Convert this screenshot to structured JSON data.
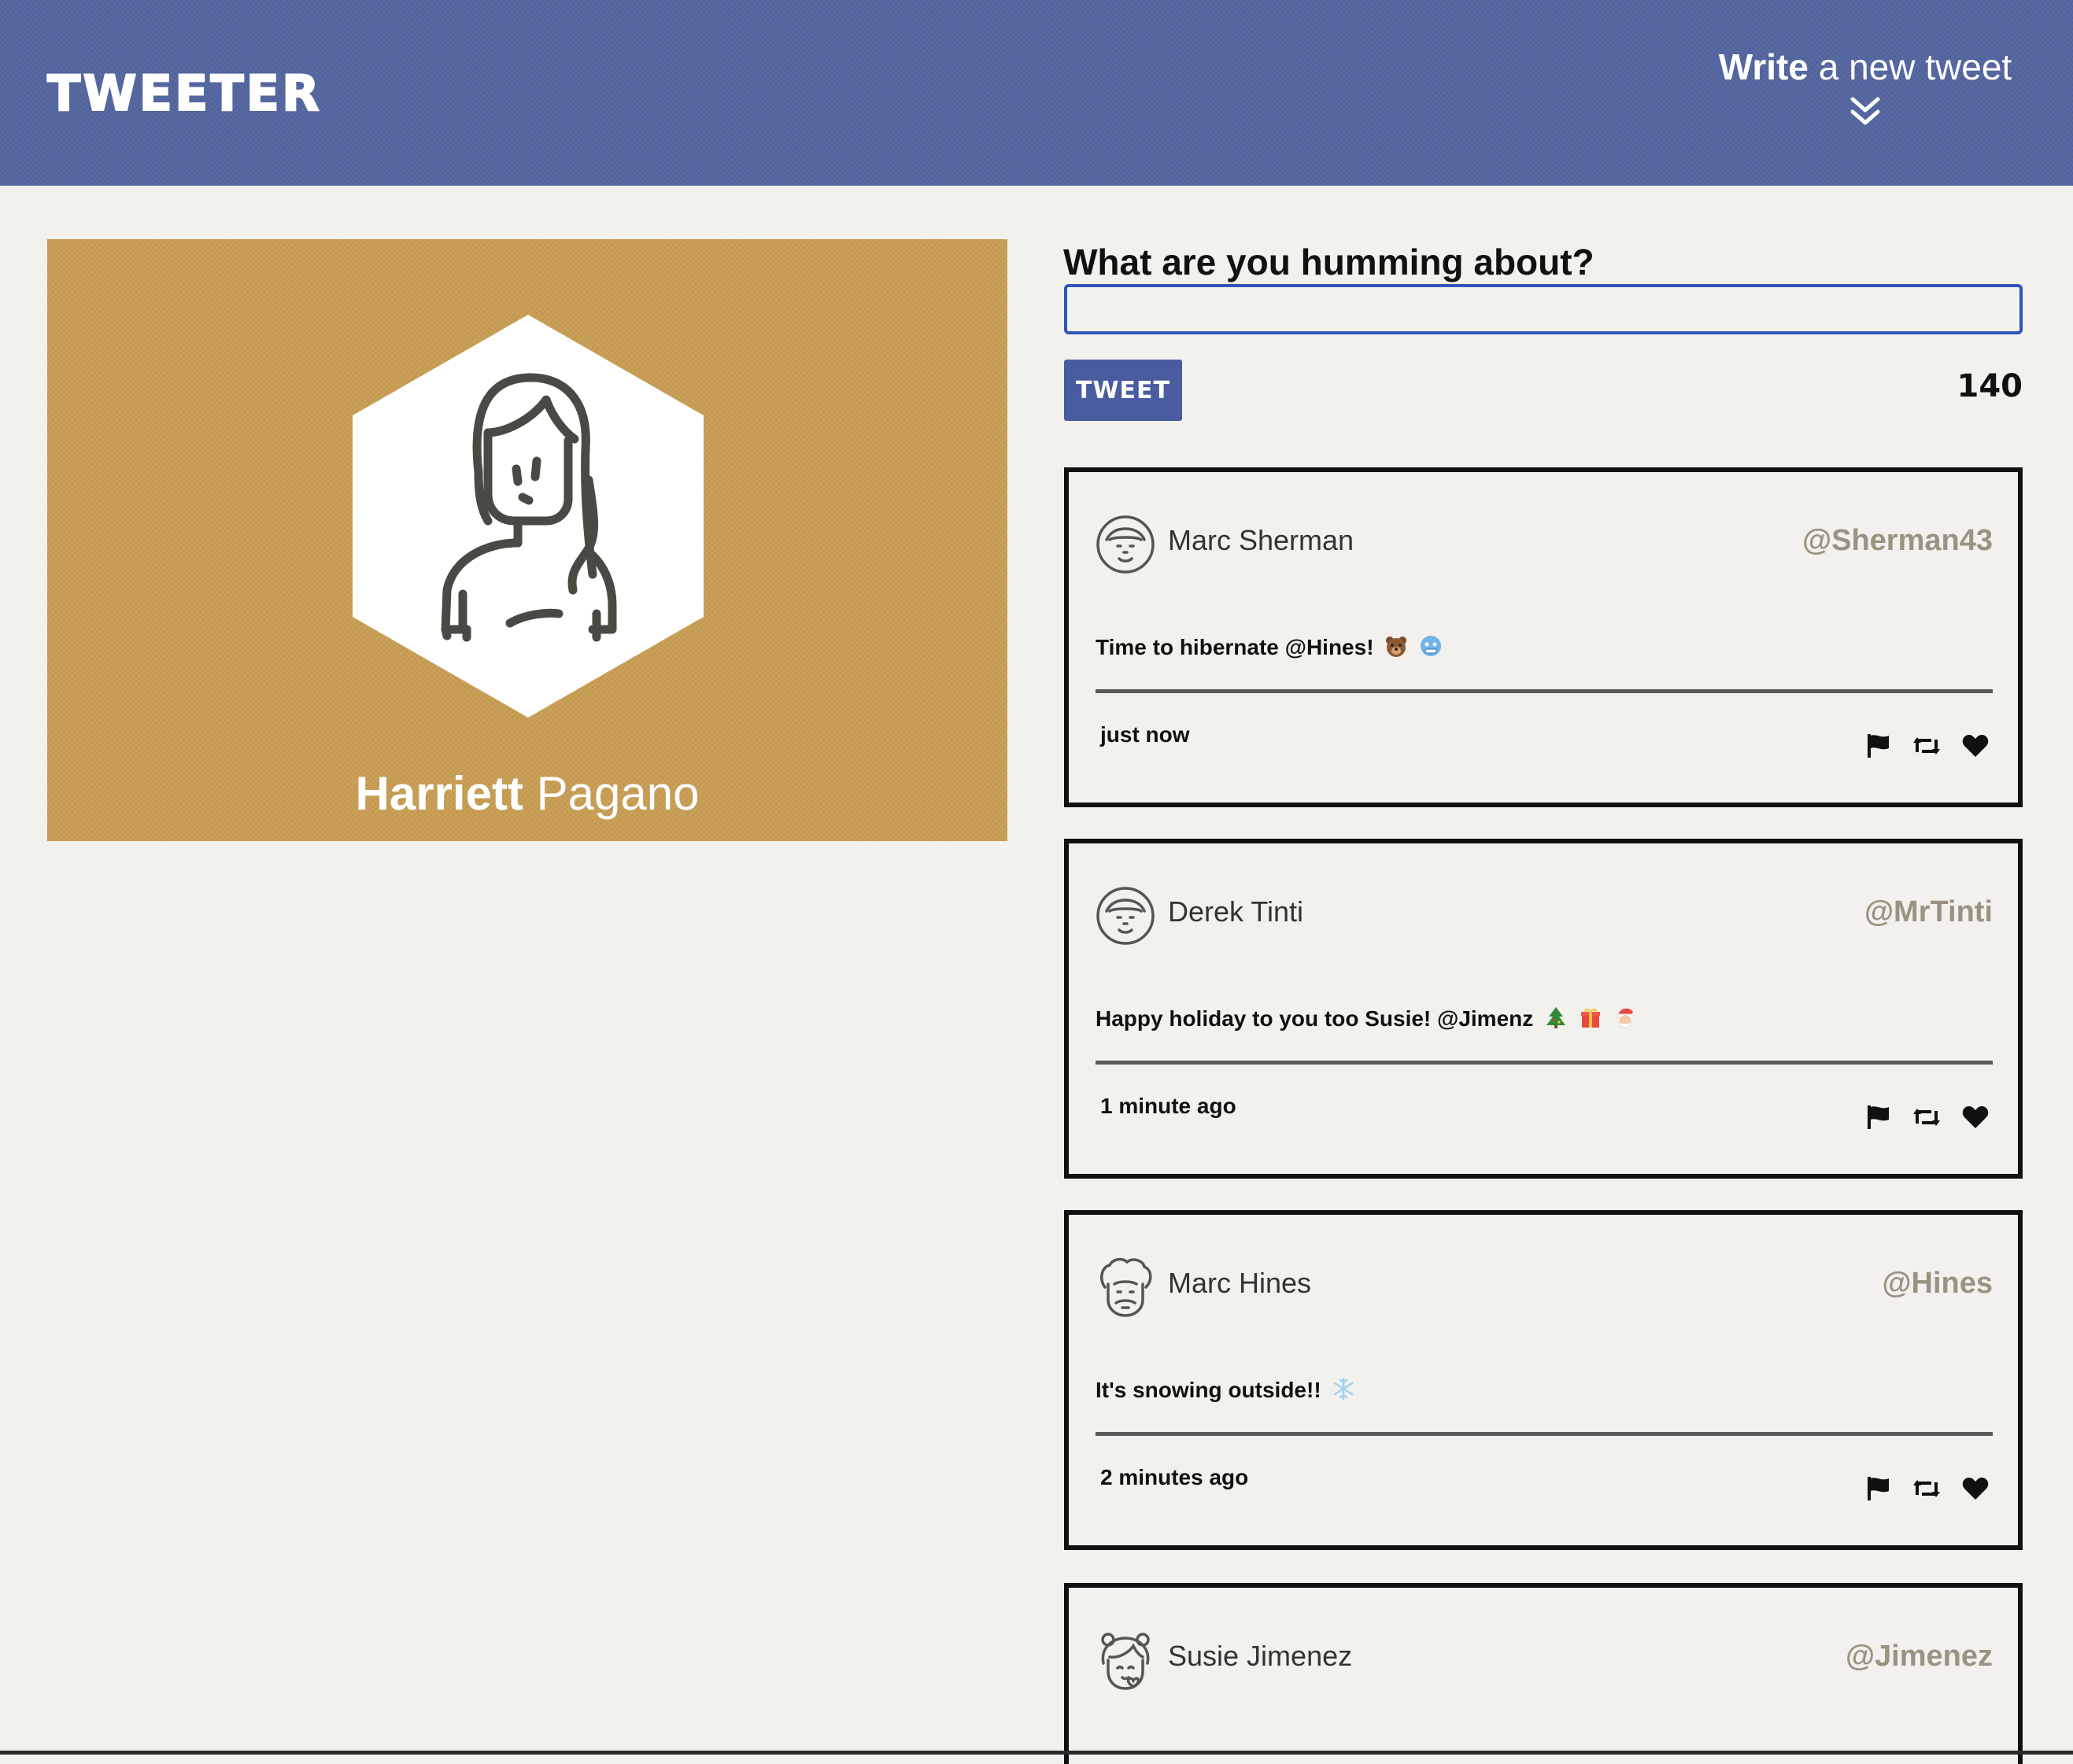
{
  "header": {
    "logo": "TWEETER",
    "compose_toggle": {
      "strong": "Write",
      "rest": "a new tweet"
    }
  },
  "profile": {
    "first_name": "Harriett",
    "last_name": "Pagano",
    "avatar_icon": "woman-avatar-icon",
    "background_color": "#c99e54"
  },
  "composer": {
    "label": "What are you humming about?",
    "value": "",
    "placeholder": "",
    "button_label": "TWEET",
    "char_counter": "140"
  },
  "tweets": [
    {
      "name": "Marc Sherman",
      "handle": "@Sherman43",
      "text": "Time to hibernate @Hines!",
      "emojis": [
        "bear",
        "cold-face"
      ],
      "time": "just now"
    },
    {
      "name": "Derek Tinti",
      "handle": "@MrTinti",
      "text": "Happy holiday to you too Susie! @Jimenz",
      "emojis": [
        "christmas-tree",
        "gift",
        "santa"
      ],
      "time": "1 minute ago"
    },
    {
      "name": "Marc Hines",
      "handle": "@Hines",
      "text": "It's snowing outside!!",
      "emojis": [
        "snowflake"
      ],
      "time": "2 minutes ago"
    },
    {
      "name": "Susie Jimenez",
      "handle": "@Jimenez",
      "text": "",
      "emojis": [],
      "time": ""
    }
  ],
  "actions": [
    "flag-icon",
    "retweet-icon",
    "heart-icon"
  ],
  "colors": {
    "header": "#5466a0",
    "tweet_button": "#4a5ca0",
    "input_border": "#2f55b8",
    "handle": "#9a9382",
    "page_bg": "#f3f1ed"
  }
}
